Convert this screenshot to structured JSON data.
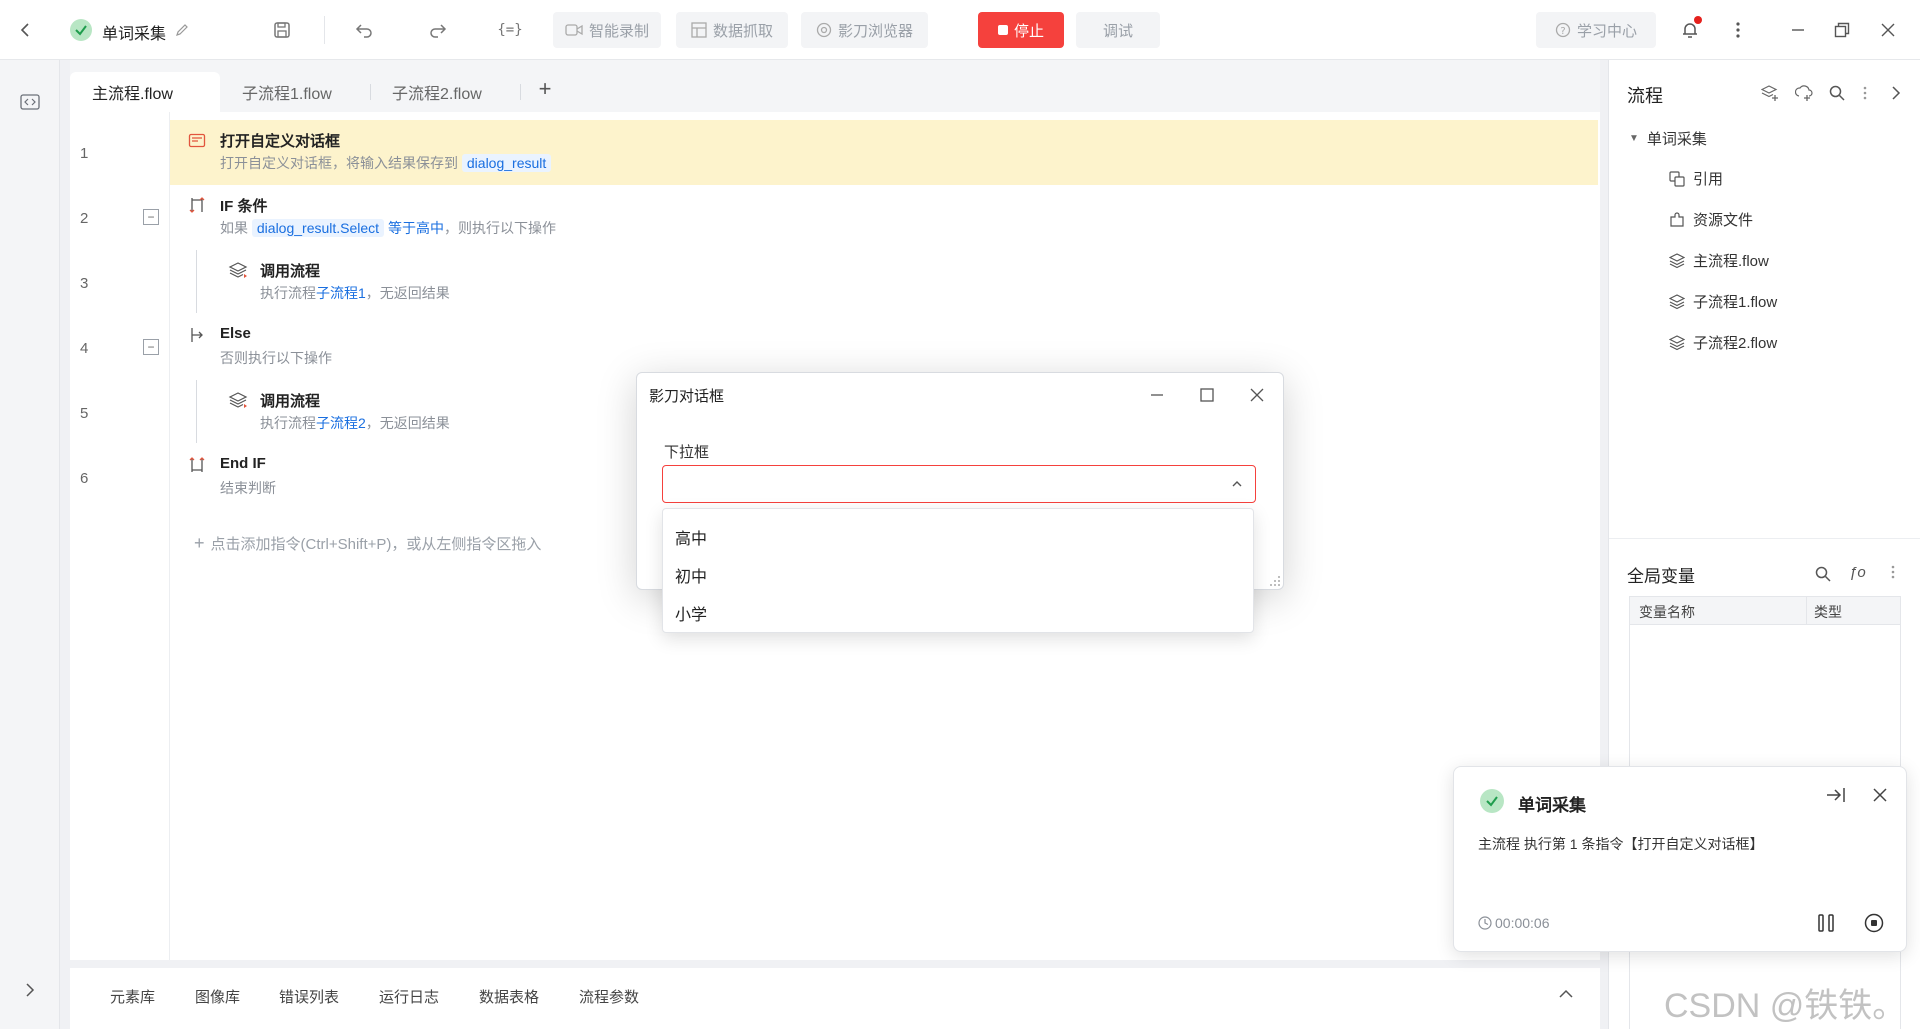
{
  "topbar": {
    "back_icon": "chevron-left-icon",
    "project_name": "单词采集",
    "smart_record": "智能录制",
    "data_capture": "数据抓取",
    "browser": "影刀浏览器",
    "stop": "停止",
    "debug": "调试",
    "learning_center": "学习中心",
    "accent_stop": "#f5413d"
  },
  "tabs": {
    "items": [
      {
        "label": "主流程.flow"
      },
      {
        "label": "子流程1.flow"
      },
      {
        "label": "子流程2.flow"
      }
    ],
    "add": "+"
  },
  "flow": {
    "lines": [
      "1",
      "2",
      "3",
      "4",
      "5",
      "6"
    ],
    "steps": [
      {
        "name": "打开自定义对话框",
        "desc_pre": "打开自定义对话框，将输入结果保存到",
        "var": "dialog_result"
      },
      {
        "name": "IF 条件",
        "desc_pre": "如果",
        "var": "dialog_result.Select",
        "cond": "等于高中",
        "desc_post": "，则执行以下操作"
      },
      {
        "name": "调用流程",
        "desc_pre": "执行流程",
        "link": "子流程1",
        "desc_post": "，无返回结果"
      },
      {
        "name": "Else",
        "desc_pre": "否则执行以下操作"
      },
      {
        "name": "调用流程",
        "desc_pre": "执行流程",
        "link": "子流程2",
        "desc_post": "，无返回结果"
      },
      {
        "name": "End IF",
        "desc_pre": "结束判断"
      }
    ],
    "add_hint": "点击添加指令(Ctrl+Shift+P)，或从左侧指令区拖入"
  },
  "bottom_tabs": [
    "元素库",
    "图像库",
    "错误列表",
    "运行日志",
    "数据表格",
    "流程参数"
  ],
  "right": {
    "title": "流程",
    "root": "单词采集",
    "items": [
      "引用",
      "资源文件",
      "主流程.flow",
      "子流程1.flow",
      "子流程2.flow"
    ],
    "globals_title": "全局变量",
    "col_name": "变量名称",
    "col_type": "类型"
  },
  "dialog": {
    "title": "影刀对话框",
    "field_label": "下拉框",
    "value": "",
    "options": [
      "高中",
      "初中",
      "小学"
    ]
  },
  "notice": {
    "title": "单词采集",
    "message": "主流程 执行第 1 条指令【打开自定义对话框】",
    "timer": "00:00:06"
  },
  "watermark": "CSDN @铁铁。"
}
